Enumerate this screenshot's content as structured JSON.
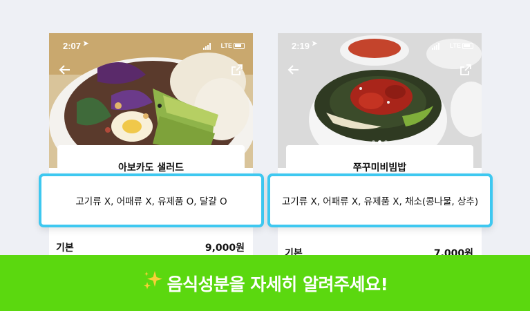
{
  "screens": [
    {
      "status_time": "2:07",
      "status_network": "LTE",
      "dish_name": "아보카도 샐러드",
      "ingredients": "고기류 X, 어패류 X, 유제품 O, 달걀 O",
      "price_label": "기본",
      "price": "9,000원"
    },
    {
      "status_time": "2:19",
      "status_network": "LTE",
      "dish_name": "쭈꾸미비빔밥",
      "ingredients": "고기류 X, 어패류 X, 유제품 X, 채소(콩나물, 상추)",
      "price_label": "기본",
      "price": "7,000원"
    }
  ],
  "banner": {
    "text": "음식성분을 자세히 알려주세요!",
    "icon": "sparkle-icon"
  },
  "colors": {
    "highlight_border": "#3ec8f0",
    "banner_bg": "#5bd80f",
    "sparkle": "#f7d038"
  }
}
